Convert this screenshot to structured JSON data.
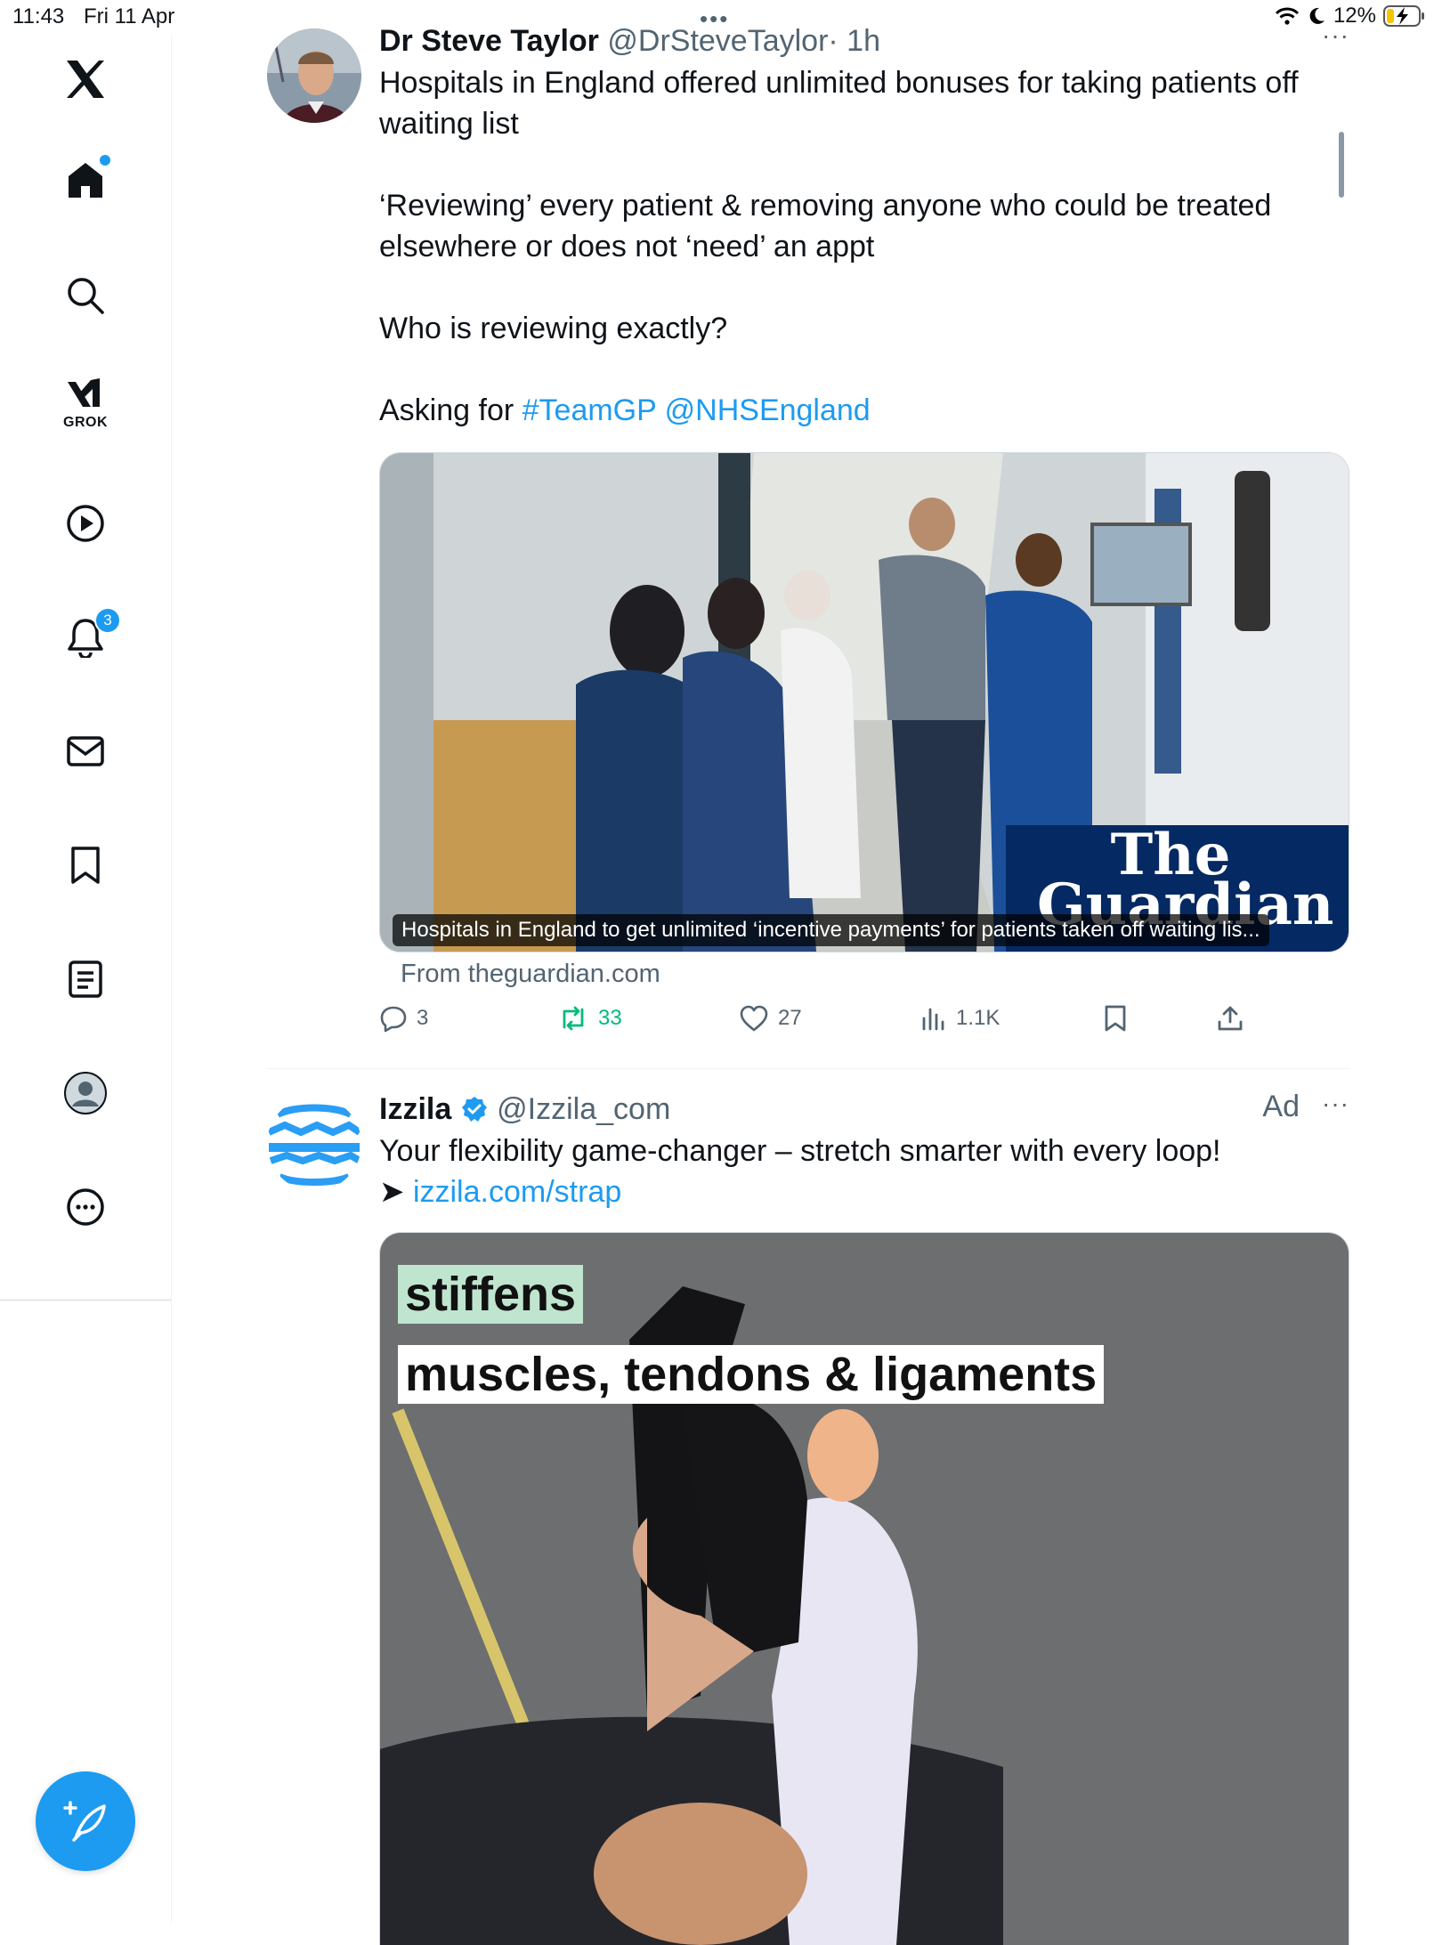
{
  "status": {
    "time": "11:43",
    "date": "Fri 11 Apr",
    "battery": "12%"
  },
  "sidebar": {
    "items": [
      {
        "id": "logo",
        "icon": "x-logo-icon"
      },
      {
        "id": "home",
        "icon": "home-icon",
        "active": true
      },
      {
        "id": "explore",
        "icon": "search-icon"
      },
      {
        "id": "grok",
        "icon": "grok-icon",
        "label": "GROK"
      },
      {
        "id": "video",
        "icon": "play-icon"
      },
      {
        "id": "notifications",
        "icon": "bell-icon",
        "badge": "3"
      },
      {
        "id": "messages",
        "icon": "mail-icon"
      },
      {
        "id": "bookmarks",
        "icon": "bookmark-icon"
      },
      {
        "id": "lists",
        "icon": "list-icon"
      },
      {
        "id": "profile",
        "icon": "avatar-icon"
      },
      {
        "id": "more",
        "icon": "more-circle-icon"
      }
    ],
    "compose_icon": "compose-icon"
  },
  "colors": {
    "accent": "#1d9bf0",
    "retweet": "#00ba7c",
    "muted": "#536471"
  },
  "tweets": [
    {
      "name": "Dr Steve Taylor",
      "handle": "@DrSteveTaylor",
      "time": "· 1h",
      "more": "···",
      "text_lines": [
        "Hospitals in England offered unlimited bonuses for taking patients off waiting list",
        "‘Reviewing’ every patient & removing anyone who could be treated elsewhere or does not ‘need’ an appt",
        "Who is reviewing exactly?"
      ],
      "asking_prefix": "Asking for ",
      "hashtag": "#TeamGP",
      "mention": "@NHSEngland",
      "card": {
        "overlay": "The Guardian",
        "caption": "Hospitals in England to get unlimited ‘incentive payments’ for patients taken off waiting lis...",
        "source": "From theguardian.com"
      },
      "actions": {
        "replies": "3",
        "retweets": "33",
        "likes": "27",
        "views": "1.1K"
      }
    },
    {
      "name": "Izzila",
      "handle": "@Izzila_com",
      "ad": "Ad",
      "more": "···",
      "text": "Your flexibility game-changer – stretch smarter with every loop!",
      "arrow": "➤",
      "link": "izzila.com/strap",
      "video_text_1": "stiffens",
      "video_text_2": "muscles, tendons & ligaments"
    }
  ]
}
